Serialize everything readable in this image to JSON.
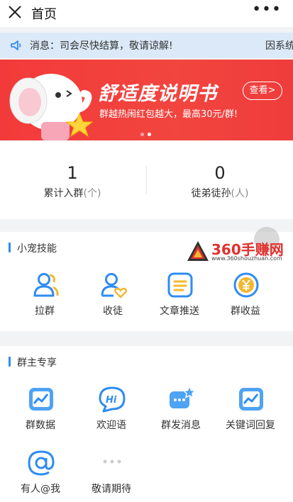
{
  "topbar": {
    "title": "首页",
    "more": "•••"
  },
  "notice": {
    "message": "消息：司会尽快结算，敬请谅解!",
    "message_tail": "因系统"
  },
  "banner": {
    "headline": "舒适度说明书",
    "subline": "群越热闹红包越大，最高30元/群!",
    "view_button": "查看>"
  },
  "stats": [
    {
      "value": "1",
      "label": "累计入群",
      "unit": "(个)"
    },
    {
      "value": "0",
      "label": "徒弟徒孙",
      "unit": "(人)"
    }
  ],
  "skills": {
    "title": "小宠技能",
    "items": [
      {
        "label": "拉群",
        "icon": "users-icon"
      },
      {
        "label": "收徒",
        "icon": "user-heart-icon"
      },
      {
        "label": "文章推送",
        "icon": "document-icon"
      },
      {
        "label": "群收益",
        "icon": "yen-coin-icon"
      }
    ]
  },
  "owner": {
    "title": "群主专享",
    "items": [
      {
        "label": "群数据",
        "icon": "chart-icon"
      },
      {
        "label": "欢迎语",
        "icon": "hi-bubble-icon"
      },
      {
        "label": "群发消息",
        "icon": "broadcast-message-icon"
      },
      {
        "label": "关键词回复",
        "icon": "keyword-reply-icon"
      },
      {
        "label": "有人@我",
        "icon": "at-icon"
      },
      {
        "label": "敬请期待",
        "icon": "more-dots-icon"
      }
    ]
  },
  "watermark": {
    "text": "360手赚网",
    "url": "www.360shouzhuan.com"
  },
  "colors": {
    "accent": "#2f8cf2",
    "banner": "#f2453f",
    "notice_bg": "#dbe9f8"
  }
}
